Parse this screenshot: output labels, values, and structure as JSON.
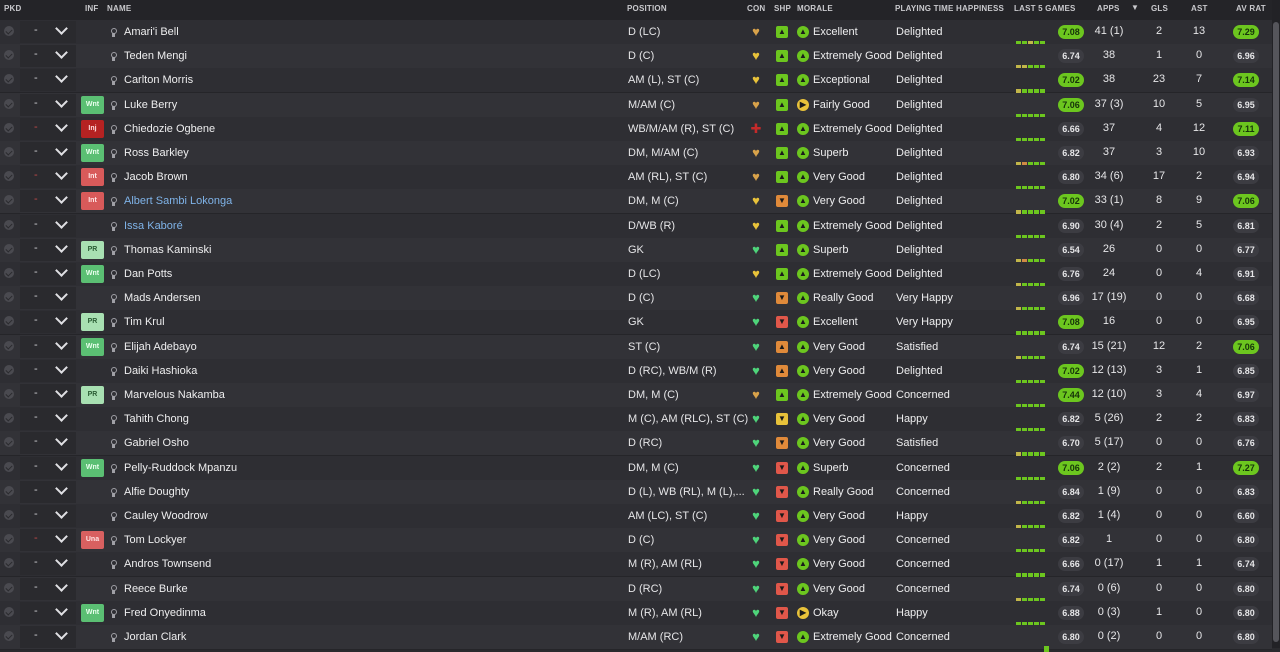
{
  "header": {
    "pkd": "PKD",
    "inf": "INF",
    "name": "NAME",
    "position": "POSITION",
    "con": "CON",
    "shp": "SHP",
    "morale": "MORALE",
    "pth": "PLAYING TIME HAPPINESS",
    "last5": "LAST 5 GAMES",
    "apps": "APPS",
    "gls": "GLS",
    "ast": "AST",
    "avrat": "AV RAT",
    "sort_icon": "caret-down-icon"
  },
  "colors": {
    "form_green": "#6cc61f",
    "form_yellow": "#c2b64a",
    "form_orange": "#d08a45",
    "rating_high": "#6cc61f"
  },
  "players": [
    {
      "dash": "-",
      "inf": "",
      "name": "Amari'i Bell",
      "pos": "D (LC)",
      "con": "ok",
      "shp": "good",
      "morale_icon": "up",
      "morale": "Excellent",
      "pth": "Delighted",
      "form": [
        "g",
        "g",
        "y",
        "g",
        "g"
      ],
      "l5": "7.08",
      "l5hi": true,
      "apps": "41 (1)",
      "gls": "2",
      "ast": "13",
      "av": "7.29",
      "avhi": true
    },
    {
      "dash": "-",
      "inf": "",
      "name": "Teden Mengi",
      "pos": "D (C)",
      "con": "warn",
      "shp": "good",
      "morale_icon": "up",
      "morale": "Extremely Good",
      "pth": "Delighted",
      "form": [
        "y",
        "y",
        "g",
        "g",
        "g"
      ],
      "l5": "6.74",
      "l5hi": false,
      "apps": "38",
      "gls": "1",
      "ast": "0",
      "av": "6.96",
      "avhi": false
    },
    {
      "dash": "-",
      "inf": "",
      "name": "Carlton Morris",
      "pos": "AM (L), ST (C)",
      "con": "warn",
      "shp": "good",
      "morale_icon": "up",
      "morale": "Exceptional",
      "pth": "Delighted",
      "form": [
        "y",
        "g",
        "g",
        "g",
        "g"
      ],
      "l5": "7.02",
      "l5hi": true,
      "apps": "38",
      "gls": "23",
      "ast": "7",
      "av": "7.14",
      "avhi": true
    },
    {
      "dash": "-",
      "inf": "Wnt",
      "name": "Luke Berry",
      "pos": "M/AM (C)",
      "con": "ok",
      "shp": "good",
      "morale_icon": "right",
      "morale": "Fairly Good",
      "pth": "Delighted",
      "form": [
        "g",
        "g",
        "g",
        "g",
        "g"
      ],
      "l5": "7.06",
      "l5hi": true,
      "apps": "37 (3)",
      "gls": "10",
      "ast": "5",
      "av": "6.95",
      "avhi": false
    },
    {
      "dash": "-",
      "inf": "Inj",
      "name": "Chiedozie Ogbene",
      "pos": "WB/M/AM (R), ST (C)",
      "con": "inj",
      "shp": "good",
      "morale_icon": "up",
      "morale": "Extremely Good",
      "pth": "Delighted",
      "form": [
        "g",
        "g",
        "g",
        "g",
        "g"
      ],
      "l5": "6.66",
      "l5hi": false,
      "apps": "37",
      "gls": "4",
      "ast": "12",
      "av": "7.11",
      "avhi": true
    },
    {
      "dash": "-",
      "inf": "Wnt",
      "name": "Ross Barkley",
      "pos": "DM, M/AM (C)",
      "con": "ok",
      "shp": "good",
      "morale_icon": "up",
      "morale": "Superb",
      "pth": "Delighted",
      "form": [
        "y",
        "o",
        "g",
        "g",
        "g"
      ],
      "l5": "6.82",
      "l5hi": false,
      "apps": "37",
      "gls": "3",
      "ast": "10",
      "av": "6.93",
      "avhi": false
    },
    {
      "dash": "-",
      "inf": "Int",
      "name": "Jacob Brown",
      "pos": "AM (RL), ST (C)",
      "con": "ok",
      "shp": "good",
      "morale_icon": "up",
      "morale": "Very Good",
      "pth": "Delighted",
      "form": [
        "g",
        "g",
        "g",
        "g",
        "g"
      ],
      "l5": "6.80",
      "l5hi": false,
      "apps": "34 (6)",
      "gls": "17",
      "ast": "2",
      "av": "6.94",
      "avhi": false
    },
    {
      "dash": "-",
      "inf": "Int",
      "name": "Albert Sambi Lokonga",
      "link": true,
      "pos": "DM, M (C)",
      "con": "warn",
      "shp": "bad",
      "morale_icon": "up",
      "morale": "Very Good",
      "pth": "Delighted",
      "form": [
        "y",
        "g",
        "g",
        "g",
        "g"
      ],
      "l5": "7.02",
      "l5hi": true,
      "apps": "33 (1)",
      "gls": "8",
      "ast": "9",
      "av": "7.06",
      "avhi": true
    },
    {
      "dash": "-",
      "inf": "",
      "name": "Issa Kaboré",
      "link": true,
      "pos": "D/WB (R)",
      "con": "warn",
      "shp": "good",
      "morale_icon": "up",
      "morale": "Extremely Good",
      "pth": "Delighted",
      "form": [
        "g",
        "g",
        "g",
        "g",
        "g"
      ],
      "l5": "6.90",
      "l5hi": false,
      "apps": "30 (4)",
      "gls": "2",
      "ast": "5",
      "av": "6.81",
      "avhi": false
    },
    {
      "dash": "-",
      "inf": "PR",
      "name": "Thomas Kaminski",
      "pos": "GK",
      "con": "full",
      "shp": "good",
      "morale_icon": "up",
      "morale": "Superb",
      "pth": "Delighted",
      "form": [
        "y",
        "o",
        "g",
        "g",
        "g"
      ],
      "l5": "6.54",
      "l5hi": false,
      "apps": "26",
      "gls": "0",
      "ast": "0",
      "av": "6.77",
      "avhi": false
    },
    {
      "dash": "-",
      "inf": "Wnt",
      "name": "Dan Potts",
      "pos": "D (LC)",
      "con": "warn",
      "shp": "good",
      "morale_icon": "up",
      "morale": "Extremely Good",
      "pth": "Delighted",
      "form": [
        "y",
        "g",
        "g",
        "g",
        "g"
      ],
      "l5": "6.76",
      "l5hi": false,
      "apps": "24",
      "gls": "0",
      "ast": "4",
      "av": "6.91",
      "avhi": false
    },
    {
      "dash": "-",
      "inf": "",
      "name": "Mads Andersen",
      "pos": "D (C)",
      "con": "full",
      "shp": "bad",
      "morale_icon": "up",
      "morale": "Really Good",
      "pth": "Very Happy",
      "form": [
        "y",
        "g",
        "g",
        "g",
        "g"
      ],
      "l5": "6.96",
      "l5hi": false,
      "apps": "17 (19)",
      "gls": "0",
      "ast": "0",
      "av": "6.68",
      "avhi": false
    },
    {
      "dash": "-",
      "inf": "PR",
      "name": "Tim Krul",
      "pos": "GK",
      "con": "full",
      "shp": "worse",
      "morale_icon": "up",
      "morale": "Excellent",
      "pth": "Very Happy",
      "form": [
        "g",
        "g",
        "g",
        "g",
        "g"
      ],
      "l5": "7.08",
      "l5hi": true,
      "apps": "16",
      "gls": "0",
      "ast": "0",
      "av": "6.95",
      "avhi": false
    },
    {
      "dash": "-",
      "inf": "Wnt",
      "name": "Elijah Adebayo",
      "pos": "ST (C)",
      "con": "full",
      "shp": "up",
      "morale_icon": "up",
      "morale": "Very Good",
      "pth": "Satisfied",
      "form": [
        "y",
        "g",
        "g",
        "g",
        "g"
      ],
      "l5": "6.74",
      "l5hi": false,
      "apps": "15 (21)",
      "gls": "12",
      "ast": "2",
      "av": "7.06",
      "avhi": true
    },
    {
      "dash": "-",
      "inf": "",
      "name": "Daiki Hashioka",
      "pos": "D (RC), WB/M (R)",
      "con": "full",
      "shp": "up",
      "morale_icon": "up",
      "morale": "Very Good",
      "pth": "Delighted",
      "form": [
        "g",
        "g",
        "g",
        "g",
        "g"
      ],
      "l5": "7.02",
      "l5hi": true,
      "apps": "12 (13)",
      "gls": "3",
      "ast": "1",
      "av": "6.85",
      "avhi": false
    },
    {
      "dash": "-",
      "inf": "PR",
      "name": "Marvelous Nakamba",
      "pos": "DM, M (C)",
      "con": "ok",
      "shp": "good",
      "morale_icon": "up",
      "morale": "Extremely Good",
      "pth": "Concerned",
      "form": [
        "g",
        "g",
        "g",
        "g",
        "g"
      ],
      "l5": "7.44",
      "l5hi": true,
      "apps": "12 (10)",
      "gls": "3",
      "ast": "4",
      "av": "6.97",
      "avhi": false
    },
    {
      "dash": "-",
      "inf": "",
      "name": "Tahith Chong",
      "pos": "M (C), AM (RLC), ST (C)",
      "con": "full",
      "shp": "warn",
      "morale_icon": "up",
      "morale": "Very Good",
      "pth": "Happy",
      "form": [
        "g",
        "g",
        "g",
        "g",
        "g"
      ],
      "l5": "6.82",
      "l5hi": false,
      "apps": "5 (26)",
      "gls": "2",
      "ast": "2",
      "av": "6.83",
      "avhi": false
    },
    {
      "dash": "-",
      "inf": "",
      "name": "Gabriel Osho",
      "pos": "D (RC)",
      "con": "full",
      "shp": "bad",
      "morale_icon": "up",
      "morale": "Very Good",
      "pth": "Satisfied",
      "form": [
        "y",
        "g",
        "g",
        "g",
        "g"
      ],
      "l5": "6.70",
      "l5hi": false,
      "apps": "5 (17)",
      "gls": "0",
      "ast": "0",
      "av": "6.76",
      "avhi": false
    },
    {
      "dash": "-",
      "inf": "Wnt",
      "name": "Pelly-Ruddock Mpanzu",
      "pos": "DM, M (C)",
      "con": "full",
      "shp": "worse",
      "morale_icon": "up",
      "morale": "Superb",
      "pth": "Concerned",
      "form": [
        "g",
        "g",
        "g",
        "g",
        "g"
      ],
      "l5": "7.06",
      "l5hi": true,
      "apps": "2 (2)",
      "gls": "2",
      "ast": "1",
      "av": "7.27",
      "avhi": true
    },
    {
      "dash": "-",
      "inf": "",
      "name": "Alfie Doughty",
      "pos": "D (L), WB (RL), M (L),...",
      "con": "full",
      "shp": "worse",
      "morale_icon": "up",
      "morale": "Really Good",
      "pth": "Concerned",
      "form": [
        "y",
        "g",
        "g",
        "g",
        "g"
      ],
      "l5": "6.84",
      "l5hi": false,
      "apps": "1 (9)",
      "gls": "0",
      "ast": "0",
      "av": "6.83",
      "avhi": false
    },
    {
      "dash": "-",
      "inf": "",
      "name": "Cauley Woodrow",
      "pos": "AM (LC), ST (C)",
      "con": "full",
      "shp": "worse",
      "morale_icon": "up",
      "morale": "Very Good",
      "pth": "Happy",
      "form": [
        "y",
        "g",
        "g",
        "g",
        "g"
      ],
      "l5": "6.82",
      "l5hi": false,
      "apps": "1 (4)",
      "gls": "0",
      "ast": "0",
      "av": "6.60",
      "avhi": false
    },
    {
      "dash": "-",
      "inf": "Una",
      "name": "Tom Lockyer",
      "pos": "D (C)",
      "con": "full",
      "shp": "worse",
      "morale_icon": "up",
      "morale": "Very Good",
      "pth": "Concerned",
      "form": [
        "g",
        "g",
        "g",
        "g",
        "g"
      ],
      "l5": "6.82",
      "l5hi": false,
      "apps": "1",
      "gls": "0",
      "ast": "0",
      "av": "6.80",
      "avhi": false
    },
    {
      "dash": "-",
      "inf": "",
      "name": "Andros Townsend",
      "pos": "M (R), AM (RL)",
      "con": "full",
      "shp": "worse",
      "morale_icon": "up",
      "morale": "Very Good",
      "pth": "Concerned",
      "form": [
        "g",
        "g",
        "g",
        "g",
        "g"
      ],
      "l5": "6.66",
      "l5hi": false,
      "apps": "0 (17)",
      "gls": "1",
      "ast": "1",
      "av": "6.74",
      "avhi": false
    },
    {
      "dash": "-",
      "inf": "",
      "name": "Reece Burke",
      "pos": "D (RC)",
      "con": "full",
      "shp": "worse",
      "morale_icon": "up",
      "morale": "Very Good",
      "pth": "Concerned",
      "form": [
        "y",
        "g",
        "g",
        "g",
        "g"
      ],
      "l5": "6.74",
      "l5hi": false,
      "apps": "0 (6)",
      "gls": "0",
      "ast": "0",
      "av": "6.80",
      "avhi": false
    },
    {
      "dash": "-",
      "inf": "Wnt",
      "name": "Fred Onyedinma",
      "pos": "M (R), AM (RL)",
      "con": "full",
      "shp": "worse",
      "morale_icon": "right",
      "morale": "Okay",
      "pth": "Happy",
      "form": [
        "g",
        "g",
        "g",
        "g",
        "g"
      ],
      "l5": "6.88",
      "l5hi": false,
      "apps": "0 (3)",
      "gls": "1",
      "ast": "0",
      "av": "6.80",
      "avhi": false
    },
    {
      "dash": "-",
      "inf": "",
      "name": "Jordan Clark",
      "pos": "M/AM (RC)",
      "con": "full",
      "shp": "worse",
      "morale_icon": "up",
      "morale": "Extremely Good",
      "pth": "Concerned",
      "form": [
        "g"
      ],
      "l5": "6.80",
      "l5hi": false,
      "apps": "0 (2)",
      "gls": "0",
      "ast": "0",
      "av": "6.80",
      "avhi": false
    }
  ]
}
